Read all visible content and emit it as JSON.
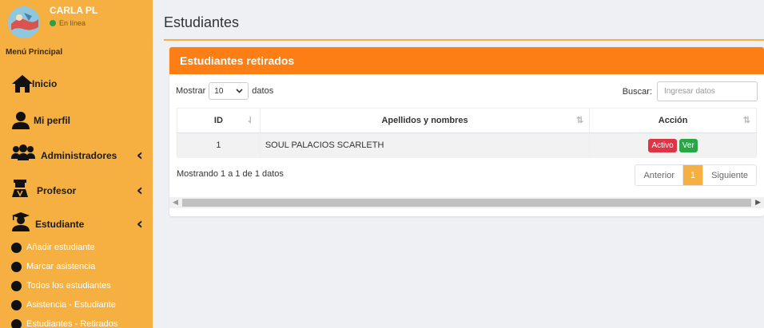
{
  "sidebar": {
    "user_name": "CARLA PL",
    "user_status": "En línea",
    "menu_header": "Menú Principal",
    "items": [
      {
        "label": "Inicio"
      },
      {
        "label": "Mi perfil"
      },
      {
        "label": "Administradores"
      },
      {
        "label": "Profesor"
      },
      {
        "label": "Estudiante"
      }
    ],
    "sub_items": [
      {
        "label": "Añadir estudiante"
      },
      {
        "label": "Marcar asistencia"
      },
      {
        "label": "Todos los estudiantes"
      },
      {
        "label": "Asistencia - Estudiante"
      },
      {
        "label": "Estudiantes - Retirados"
      }
    ]
  },
  "page": {
    "title": "Estudiantes"
  },
  "card": {
    "title": "Estudiantes retirados",
    "show_label": "Mostrar",
    "show_value": "10",
    "show_suffix": "datos",
    "search_label": "Buscar:",
    "search_placeholder": "Ingresar datos",
    "columns": [
      "ID",
      "Apellidos y nombres",
      "Acción"
    ],
    "rows": [
      {
        "id": "1",
        "name": "SOUL PALACIOS SCARLETH",
        "status_btn": "Activo",
        "view_btn": "Ver"
      }
    ],
    "info": "Mostrando 1 a 1 de 1 datos",
    "pager": {
      "prev": "Anterior",
      "current": "1",
      "next": "Siguiente"
    }
  },
  "colors": {
    "sidebar": "#f5b041",
    "card_header": "#fd7e14",
    "btn_active": "#dc3545",
    "btn_view": "#28a745"
  }
}
